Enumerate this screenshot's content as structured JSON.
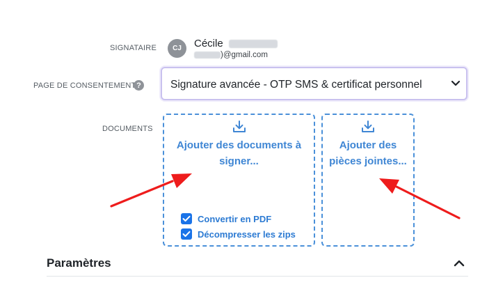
{
  "signer": {
    "label": "SIGNATAIRE",
    "avatar_initials": "CJ",
    "first_name": "Cécile",
    "email_suffix": ")@gmail.com"
  },
  "consent": {
    "label": "PAGE DE CONSENTEMENT",
    "help_glyph": "?",
    "selected_option": "Signature avancée - OTP SMS & certificat personnel"
  },
  "documents": {
    "label": "DOCUMENTS",
    "add_documents_line1": "Ajouter des documents à",
    "add_documents_line2": "signer...",
    "convert_pdf_label": "Convertir en PDF",
    "unzip_label": "Décompresser les zips",
    "add_attachments_line1": "Ajouter des",
    "add_attachments_line2": "pièces jointes..."
  },
  "parameters": {
    "title": "Paramètres"
  },
  "colors": {
    "accent_blue": "#3f86d4",
    "checkbox_blue": "#1a73e8",
    "select_border": "#c9c1ef",
    "annotation_arrow": "#ee1c1c"
  }
}
